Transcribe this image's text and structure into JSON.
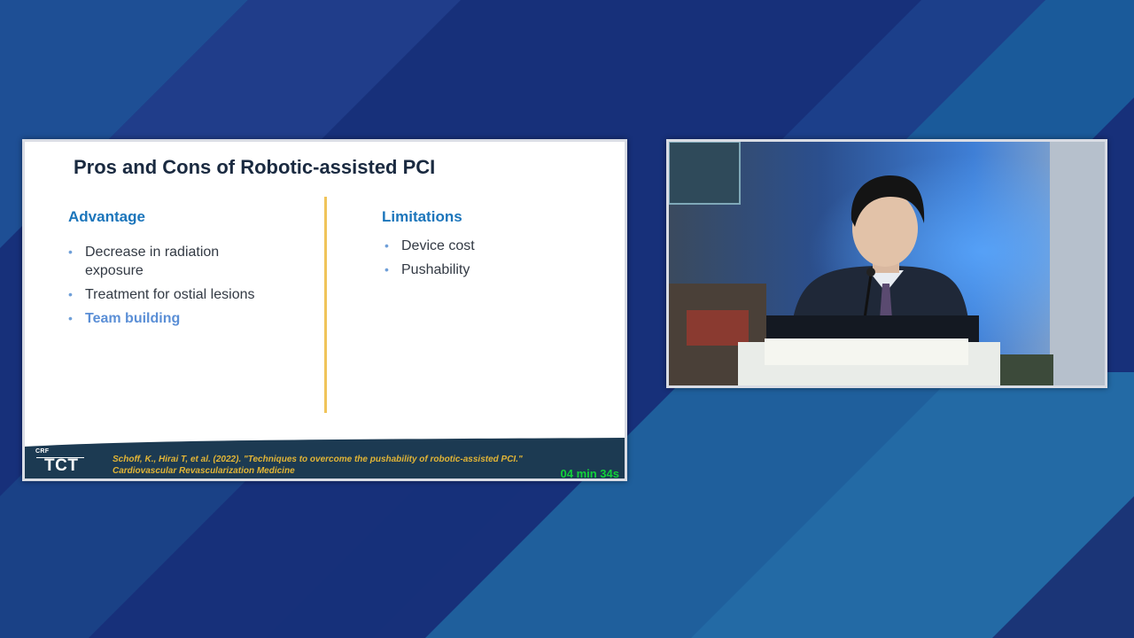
{
  "slide": {
    "title": "Pros and Cons of Robotic-assisted PCI",
    "left_column": {
      "heading": "Advantage",
      "items": [
        "Decrease in radiation exposure",
        "Treatment for ostial lesions",
        "Team building"
      ]
    },
    "right_column": {
      "heading": "Limitations",
      "items": [
        "Device cost",
        "Pushability"
      ]
    },
    "footer": {
      "logo_small": "CRF",
      "logo_main": "TCT",
      "citation_line1": "Schoff, K., Hirai T, et al. (2022). \"Techniques to overcome the pushability of robotic-assisted PCI.\"",
      "citation_line2": "Cardiovascular Revascularization Medicine",
      "timer": "04 min 34s"
    }
  },
  "colors": {
    "background": "#17307a",
    "accent_blue": "#1b75bb",
    "divider_gold": "#f0c45a",
    "citation_gold": "#e2b536",
    "timer_green": "#12d23a"
  }
}
